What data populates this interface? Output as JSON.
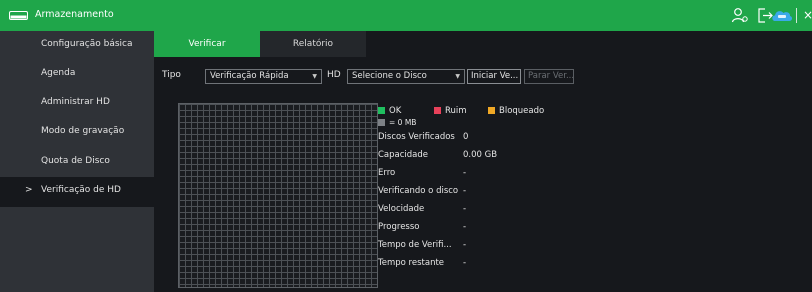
{
  "window": {
    "title": "Armazenamento",
    "title_icon": "hdd-icon",
    "toolbar_icons": [
      "user-settings-icon",
      "logout-icon",
      "cloud-icon",
      "close-icon"
    ],
    "cloud_badge": "Intelbras Cloud",
    "close_glyph": "×"
  },
  "sidebar": {
    "items": [
      {
        "label": "Configuração básica",
        "active": false
      },
      {
        "label": "Agenda",
        "active": false
      },
      {
        "label": "Administrar HD",
        "active": false
      },
      {
        "label": "Modo de gravação",
        "active": false
      },
      {
        "label": "Quota de Disco",
        "active": false
      },
      {
        "label": "Verificação de HD",
        "active": true,
        "marker": ">"
      }
    ]
  },
  "tabs": [
    {
      "label": "Verificar",
      "active": true
    },
    {
      "label": "Relatório",
      "active": false
    }
  ],
  "controls": {
    "tipo_label": "Tipo",
    "tipo_value": "Verificação Rápida",
    "hd_label": "HD",
    "hd_value": "Selecione o Disco",
    "start_button": "Iniciar Ve...",
    "stop_button": "Parar Ver..."
  },
  "legend": {
    "ok": "OK",
    "bad": "Ruim",
    "blocked": "Bloqueado",
    "unit": "= 0 MB"
  },
  "info": [
    {
      "label": "Discos Verificados",
      "value": "0"
    },
    {
      "label": "Capacidade",
      "value": "0.00 GB"
    },
    {
      "label": "Erro",
      "value": "-"
    },
    {
      "label": "Verificando o disco",
      "value": "-"
    },
    {
      "label": "Velocidade",
      "value": "-"
    },
    {
      "label": "Progresso",
      "value": "-"
    },
    {
      "label": "Tempo de Verifi...",
      "value": "-"
    },
    {
      "label": "Tempo restante",
      "value": "-"
    }
  ],
  "colors": {
    "accent": "#1fa64a",
    "ok": "#1fbf5f",
    "bad": "#e8415a",
    "blocked": "#f0a825",
    "unit": "#7d8186"
  }
}
